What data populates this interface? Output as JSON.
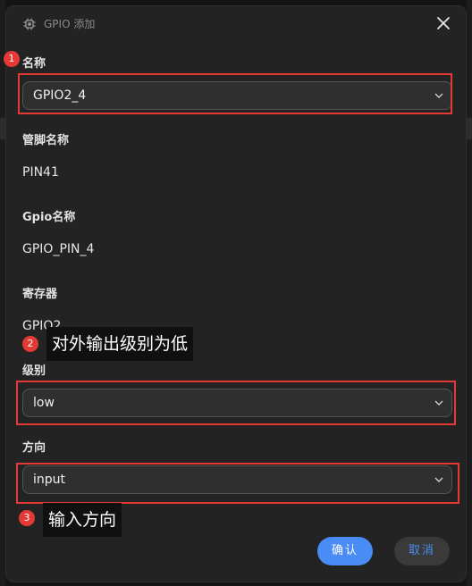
{
  "dialog": {
    "title": "GPIO 添加",
    "close_icon": "close-icon"
  },
  "form": {
    "name_label": "名称",
    "name_value": "GPIO2_4",
    "pin_name_label": "管脚名称",
    "pin_name_value": "PIN41",
    "gpio_name_label": "Gpio名称",
    "gpio_name_value": "GPIO_PIN_4",
    "register_label": "寄存器",
    "register_value": "GPIO2",
    "level_label": "级别",
    "level_value": "low",
    "direction_label": "方向",
    "direction_value": "input"
  },
  "annotations": {
    "marker1": "1",
    "marker2": "2",
    "marker3": "3",
    "note2": "对外输出级别为低",
    "note3": "输入方向",
    "highlight_color": "#e53935"
  },
  "buttons": {
    "ok_label": "确认",
    "cancel_label": "取消"
  },
  "colors": {
    "primary": "#4a8cf5",
    "background": "#232323"
  }
}
